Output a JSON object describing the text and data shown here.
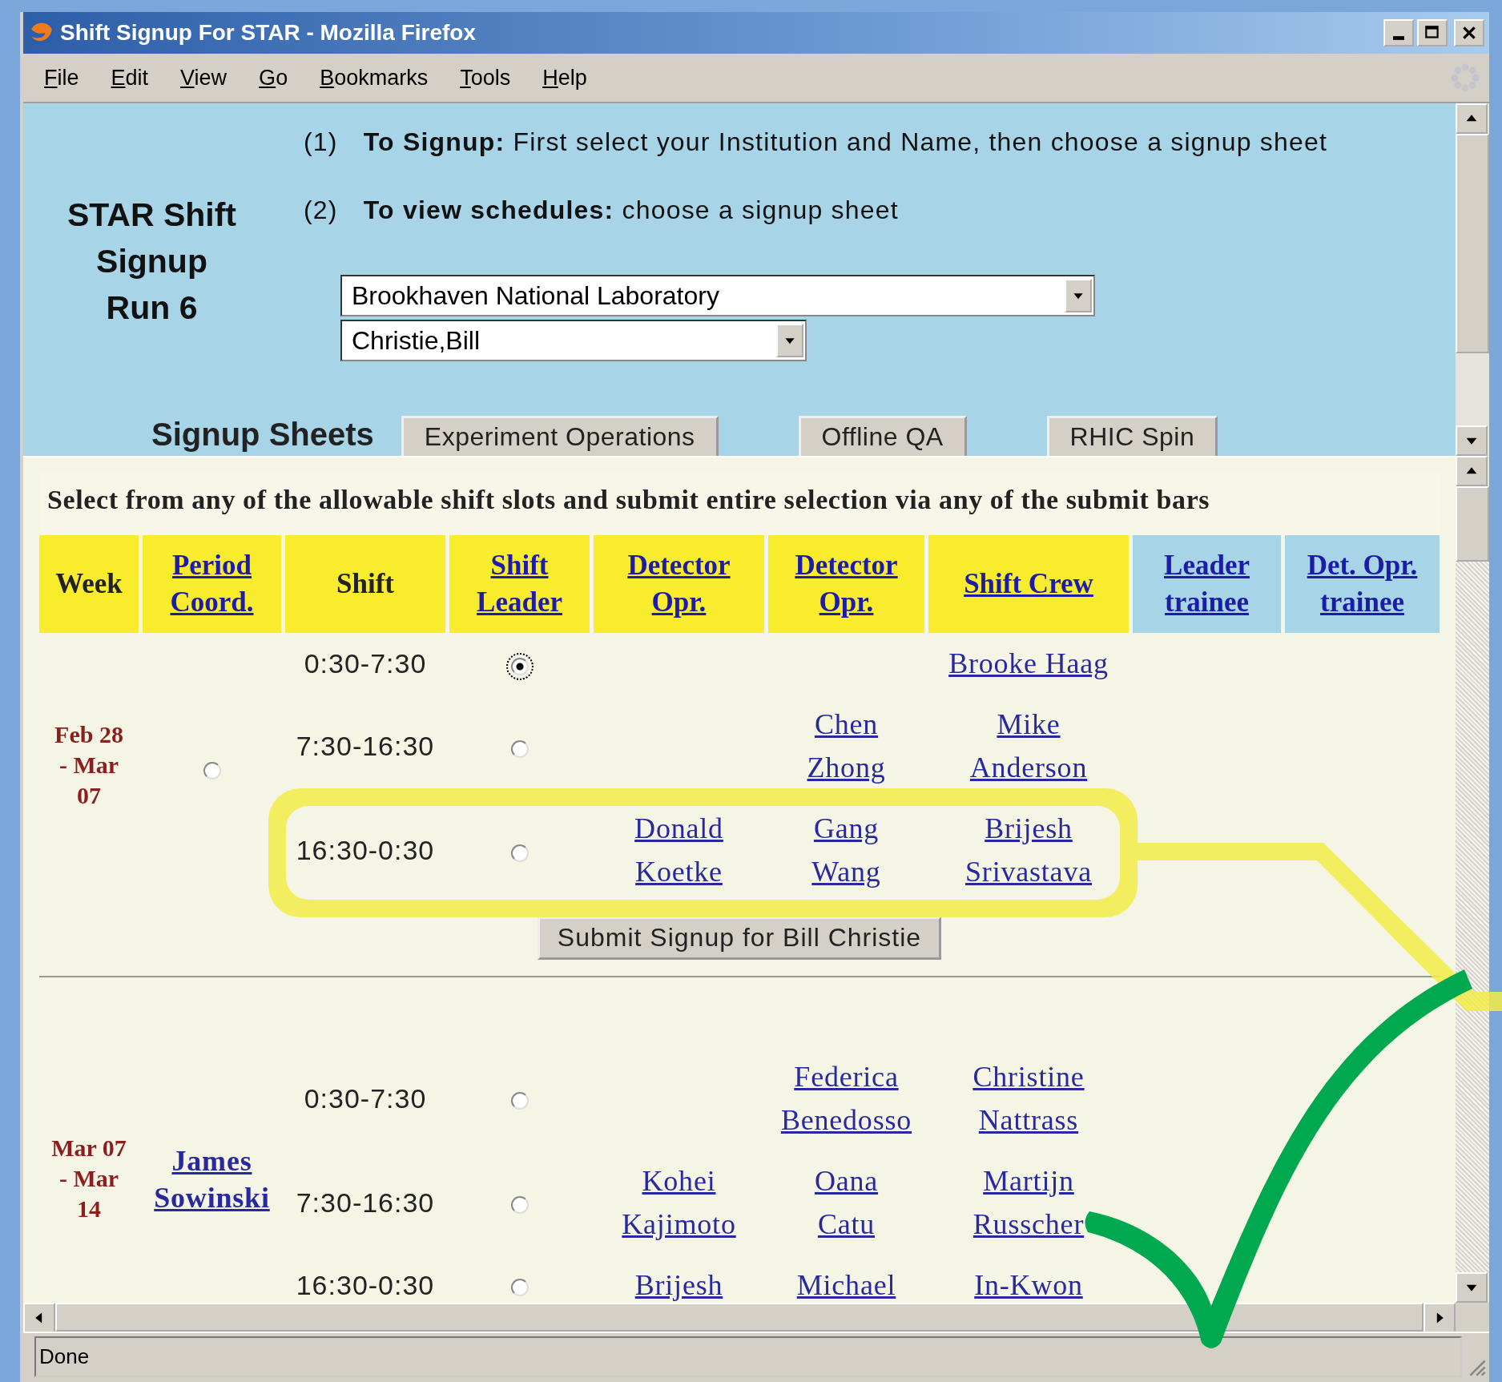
{
  "window": {
    "title": "Shift Signup For STAR - Mozilla Firefox"
  },
  "menu": [
    {
      "label": "File"
    },
    {
      "label": "Edit"
    },
    {
      "label": "View"
    },
    {
      "label": "Go"
    },
    {
      "label": "Bookmarks"
    },
    {
      "label": "Tools"
    },
    {
      "label": "Help"
    }
  ],
  "header": {
    "title": "STAR Shift Signup Run 6",
    "instructions": [
      {
        "number": "(1)",
        "text": "**To Signup:** First select your Institution and Name, then choose a signup sheet"
      },
      {
        "number": "(2)",
        "text": "**To view schedules:** choose a signup sheet"
      }
    ],
    "institution_select": {
      "value": "Brookhaven National Laboratory"
    },
    "name_select": {
      "value": "Christie,Bill"
    },
    "sheets_label": "Signup Sheets",
    "sheet_tabs": [
      {
        "label": "Experiment Operations"
      },
      {
        "label": "Offline QA"
      },
      {
        "label": "RHIC Spin"
      }
    ]
  },
  "table": {
    "caption": "Select from any of the allowable shift slots and submit entire selection via any of the submit bars",
    "columns": [
      {
        "label": "Week",
        "kind": "text",
        "color": "#f8ec2c"
      },
      {
        "label": "Period Coord.",
        "kind": "link",
        "color": "#f8ec2c"
      },
      {
        "label": "Shift",
        "kind": "text",
        "color": "#f8ec2c"
      },
      {
        "label": "Shift Leader",
        "kind": "link",
        "color": "#f8ec2c"
      },
      {
        "label": "Detector Opr.",
        "kind": "link",
        "color": "#f8ec2c"
      },
      {
        "label": "Detector Opr.",
        "kind": "link",
        "color": "#f8ec2c"
      },
      {
        "label": "Shift Crew",
        "kind": "link",
        "color": "#f8ec2c"
      },
      {
        "label": "Leader trainee",
        "kind": "link",
        "color": "#a8d4e8"
      },
      {
        "label": "Det. Opr. trainee",
        "kind": "link",
        "color": "#a8d4e8"
      }
    ],
    "weeks": [
      {
        "week": "Feb 28 - Mar 07",
        "period_coord": {
          "kind": "radio",
          "selected": false
        },
        "shifts": [
          {
            "time": "0:30-7:30",
            "leader_radio": {
              "selected": true
            },
            "shift_crew": "Brooke Haag"
          },
          {
            "time": "7:30-16:30",
            "leader_radio": {
              "selected": false
            },
            "detector_opr_2": "Chen Zhong",
            "shift_crew": "Mike Anderson"
          },
          {
            "time": "16:30-0:30",
            "leader_radio": {
              "selected": false
            },
            "detector_opr_1": "Donald Koetke",
            "detector_opr_2": "Gang Wang",
            "shift_crew": "Brijesh Srivastava"
          }
        ],
        "submit_button": "Submit Signup for Bill Christie"
      },
      {
        "week": "Mar 07 - Mar 14",
        "period_coord": {
          "kind": "link",
          "text": "James Sowinski"
        },
        "shifts": [
          {
            "time": "0:30-7:30",
            "leader_radio": {
              "selected": false
            },
            "detector_opr_2": "Federica Benedosso",
            "shift_crew": "Christine Nattrass"
          },
          {
            "time": "7:30-16:30",
            "leader_radio": {
              "selected": false
            },
            "detector_opr_1": "Kohei Kajimoto",
            "detector_opr_2": "Oana Catu",
            "shift_crew": "Martijn Russcher"
          },
          {
            "time": "16:30-0:30",
            "leader_radio": {
              "selected": false
            },
            "detector_opr_1": "Brijesh",
            "detector_opr_2": "Michael",
            "shift_crew": "In-Kwon"
          }
        ]
      }
    ]
  },
  "status_bar": {
    "text": "Done"
  }
}
